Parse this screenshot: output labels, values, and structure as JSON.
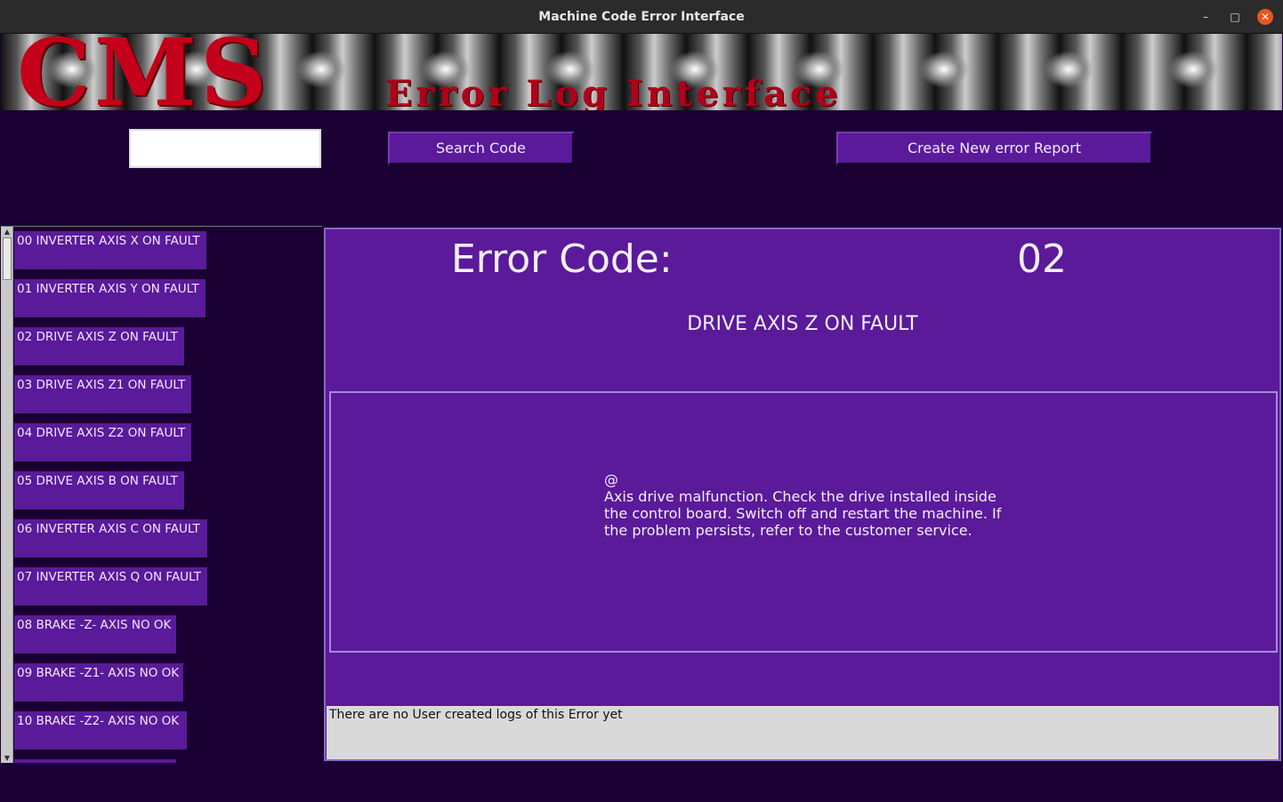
{
  "window": {
    "title": "Machine Code Error Interface",
    "minimize": "–",
    "maximize": "□",
    "close": "✕"
  },
  "banner": {
    "logo": "CMS",
    "subtitle": "Error Log Interface"
  },
  "toolbar": {
    "search_value": "",
    "search_label": "Search Code",
    "create_label": "Create New error Report"
  },
  "error_list": [
    "00 INVERTER AXIS X ON FAULT",
    "01 INVERTER AXIS Y ON FAULT",
    "02 DRIVE AXIS Z ON FAULT",
    "03 DRIVE AXIS Z1 ON FAULT",
    "04 DRIVE AXIS Z2 ON FAULT",
    "05 DRIVE AXIS B ON FAULT",
    "06 INVERTER AXIS C ON FAULT",
    "07 INVERTER AXIS Q ON FAULT",
    "08 BRAKE -Z- AXIS NO OK",
    "09 BRAKE -Z1- AXIS NO OK",
    "10 BRAKE -Z2- AXIS NO OK",
    ""
  ],
  "detail": {
    "label": "Error Code:",
    "code": "02",
    "name": "DRIVE AXIS Z ON FAULT",
    "description": "@\nAxis drive malfunction. Check the drive installed inside the control board. Switch off and restart the machine. If the problem persists, refer to the customer service.",
    "logs": "There are no User created logs of this Error yet"
  },
  "colors": {
    "background": "#1a0033",
    "accent": "#5a1a9a",
    "logo": "#c4001a"
  }
}
